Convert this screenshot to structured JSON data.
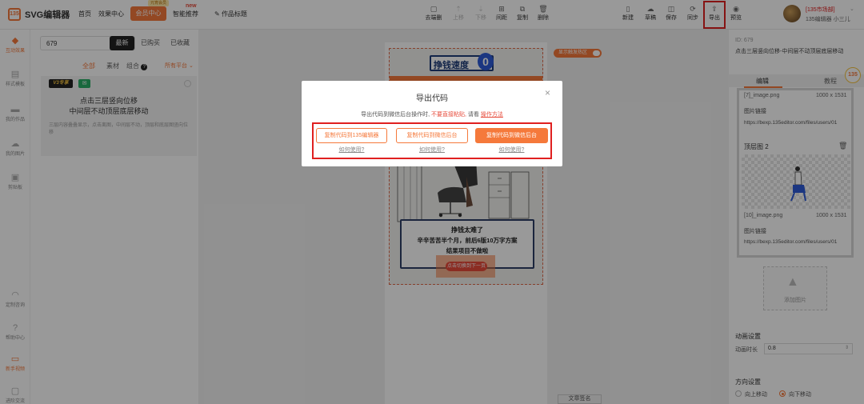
{
  "topbar": {
    "logo_mark": "135",
    "logo_text": "SVG编辑器",
    "nav": [
      "首页",
      "效果中心"
    ],
    "member_button": "会员中心",
    "member_tag": "元宵会员",
    "smart_recommend": "智能推荐",
    "new_badge": "new",
    "title_placeholder": "作品标题",
    "tools": [
      "去端删",
      "上移",
      "下移",
      "间距",
      "复制",
      "删除"
    ],
    "actions": [
      "新建",
      "草稿",
      "保存",
      "同步",
      "导出",
      "预览"
    ],
    "user_level": "[135市场部]",
    "user_name": "135编辑器 小三儿",
    "accent": "#f5793b"
  },
  "leftrail": {
    "items": [
      "互动效果",
      "样式模板",
      "我的作品",
      "我的图片",
      "剪贴板"
    ],
    "bottom_items": [
      "定制咨询",
      "帮助中心",
      "新手视频",
      "进阶交流"
    ]
  },
  "panel": {
    "search_value": "679",
    "tabs": [
      "最新",
      "已购买",
      "已收藏"
    ],
    "filters": [
      "全部",
      "素材",
      "组合"
    ],
    "platform_filter": "所有平台",
    "card": {
      "badge": "V3专享",
      "title_line1": "点击三层竖向位移",
      "title_line2": "中间层不动顶层底层移动",
      "desc": "三层内容叠叠显示，点击离图，中间层不动，顶层和底层图竖向位移"
    }
  },
  "canvas": {
    "display_toggle": "显示触发热区",
    "art_title": "挣钱速度",
    "art_zero": "0",
    "bubble_lines": [
      "挣钱太难了",
      "辛辛苦苦半个月，前后6版10万字方案",
      "结果项目不做啦"
    ],
    "hotspot_label": "点击切换到下一页",
    "bottom_label": "文章签名"
  },
  "rightpanel": {
    "id_label": "ID: 679",
    "effect_name": "点击三层竖向位移-中间层不动顶层底层移动",
    "tabs": [
      "编辑",
      "教程"
    ],
    "layer1": {
      "file": "[7]_image.png",
      "size": "1000 x 1531",
      "link_label": "图片链接",
      "link": "https://bexp.135editor.com/files/users/01"
    },
    "layer2": {
      "name": "顶层图 2",
      "file": "[10]_image.png",
      "size": "1000 x 1531",
      "link_label": "图片链接",
      "link": "https://bexp.135editor.com/files/users/01"
    },
    "add_image": "添加图片",
    "anim_section": "动画设置",
    "anim_duration_label": "动画时长",
    "anim_duration": "0.8",
    "direction_section": "方向设置",
    "direction_options": [
      "向上移动",
      "向下移动"
    ],
    "direction_selected": "向下移动",
    "float_badge": "135"
  },
  "modal": {
    "title": "导出代码",
    "desc_prefix": "导出代码到微信后台操作时,",
    "desc_warning": "不要直接粘贴,",
    "desc_mid": "请看",
    "desc_link": "操作方法",
    "buttons": [
      "复制代码到135编辑器",
      "复制代码到微信后台",
      "复制代码到微信后台"
    ],
    "help_link": "如何使用?",
    "close": "×"
  }
}
